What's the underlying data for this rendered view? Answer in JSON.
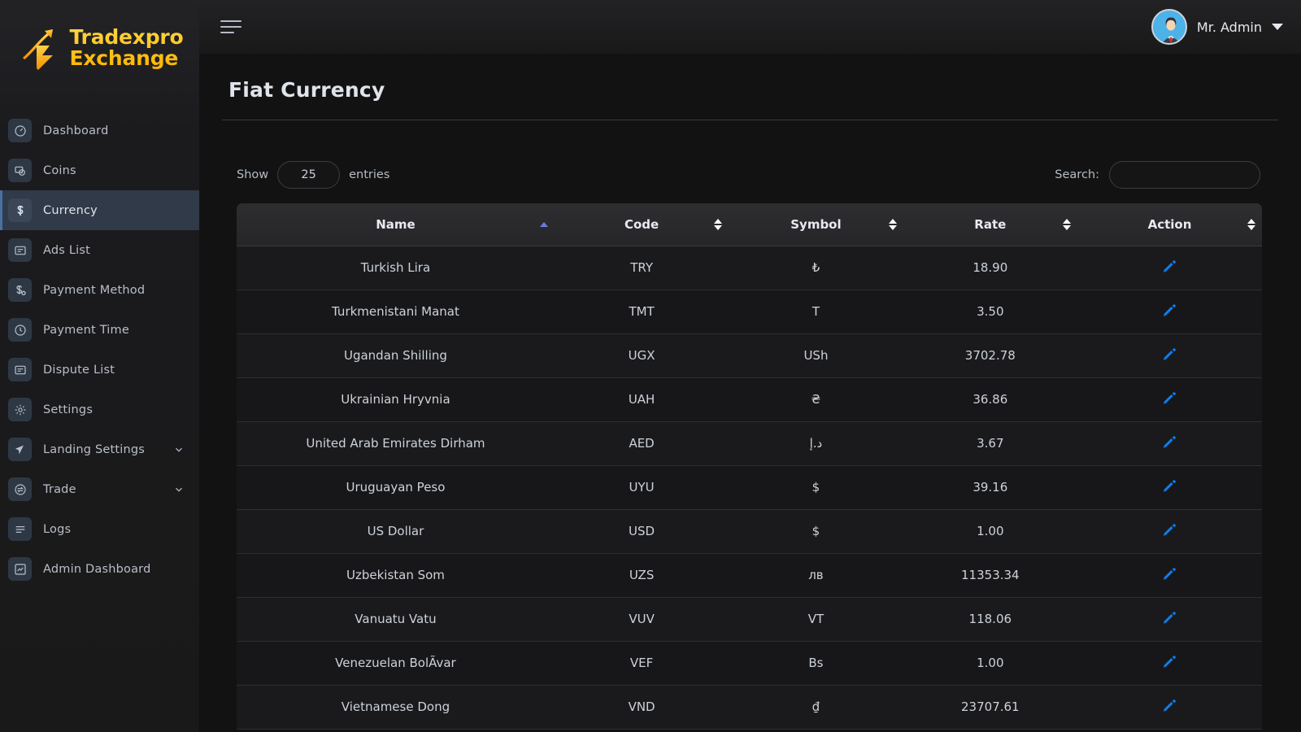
{
  "brand": {
    "line1": "Tradexpro",
    "line2": "Exchange",
    "icon": "arrow-growth-logo"
  },
  "sidebar": {
    "items": [
      {
        "label": "Dashboard",
        "icon": "speedometer-icon",
        "active": false,
        "expandable": false
      },
      {
        "label": "Coins",
        "icon": "coins-icon",
        "active": false,
        "expandable": false
      },
      {
        "label": "Currency",
        "icon": "dollar-icon",
        "active": true,
        "expandable": false
      },
      {
        "label": "Ads List",
        "icon": "list-card-icon",
        "active": false,
        "expandable": false
      },
      {
        "label": "Payment Method",
        "icon": "dollar-gear-icon",
        "active": false,
        "expandable": false
      },
      {
        "label": "Payment Time",
        "icon": "clock-icon",
        "active": false,
        "expandable": false
      },
      {
        "label": "Dispute List",
        "icon": "list-card-icon",
        "active": false,
        "expandable": false
      },
      {
        "label": "Settings",
        "icon": "gear-icon",
        "active": false,
        "expandable": false
      },
      {
        "label": "Landing Settings",
        "icon": "cursor-arrow-icon",
        "active": false,
        "expandable": true
      },
      {
        "label": "Trade",
        "icon": "exchange-icon",
        "active": false,
        "expandable": true
      },
      {
        "label": "Logs",
        "icon": "lines-icon",
        "active": false,
        "expandable": false
      },
      {
        "label": "Admin Dashboard",
        "icon": "chart-line-icon",
        "active": false,
        "expandable": false
      }
    ]
  },
  "topbar": {
    "menu_toggle": "hamburger-icon",
    "user_name": "Mr. Admin",
    "avatar": "admin-avatar",
    "caret": "chevron-down-icon"
  },
  "page": {
    "title": "Fiat Currency"
  },
  "controls": {
    "show_label": "Show",
    "entries_value": "25",
    "entries_label": "entries",
    "search_label": "Search:",
    "search_value": "",
    "search_placeholder": ""
  },
  "table": {
    "columns": [
      {
        "label": "Name",
        "sort": "asc"
      },
      {
        "label": "Code",
        "sort": "none"
      },
      {
        "label": "Symbol",
        "sort": "none"
      },
      {
        "label": "Rate",
        "sort": "none"
      },
      {
        "label": "Action",
        "sort": "none"
      }
    ],
    "action_icon": "edit-pencil-icon",
    "rows": [
      {
        "name": "Turkish Lira",
        "code": "TRY",
        "symbol": "₺",
        "rate": "18.90"
      },
      {
        "name": "Turkmenistani Manat",
        "code": "TMT",
        "symbol": "T",
        "rate": "3.50"
      },
      {
        "name": "Ugandan Shilling",
        "code": "UGX",
        "symbol": "USh",
        "rate": "3702.78"
      },
      {
        "name": "Ukrainian Hryvnia",
        "code": "UAH",
        "symbol": "₴",
        "rate": "36.86"
      },
      {
        "name": "United Arab Emirates Dirham",
        "code": "AED",
        "symbol": "د.إ",
        "rate": "3.67"
      },
      {
        "name": "Uruguayan Peso",
        "code": "UYU",
        "symbol": "$",
        "rate": "39.16"
      },
      {
        "name": "US Dollar",
        "code": "USD",
        "symbol": "$",
        "rate": "1.00"
      },
      {
        "name": "Uzbekistan Som",
        "code": "UZS",
        "symbol": "лв",
        "rate": "11353.34"
      },
      {
        "name": "Vanuatu Vatu",
        "code": "VUV",
        "symbol": "VT",
        "rate": "118.06"
      },
      {
        "name": "Venezuelan BolÃvar",
        "code": "VEF",
        "symbol": "Bs",
        "rate": "1.00"
      },
      {
        "name": "Vietnamese Dong",
        "code": "VND",
        "symbol": "₫",
        "rate": "23707.61"
      }
    ]
  },
  "colors": {
    "accent_blue": "#0d7ef0",
    "sort_active": "#6c7ae0",
    "brand_gold": "#ffc107",
    "sidebar_active_bg": "#303a48",
    "page_bg": "#121213"
  }
}
